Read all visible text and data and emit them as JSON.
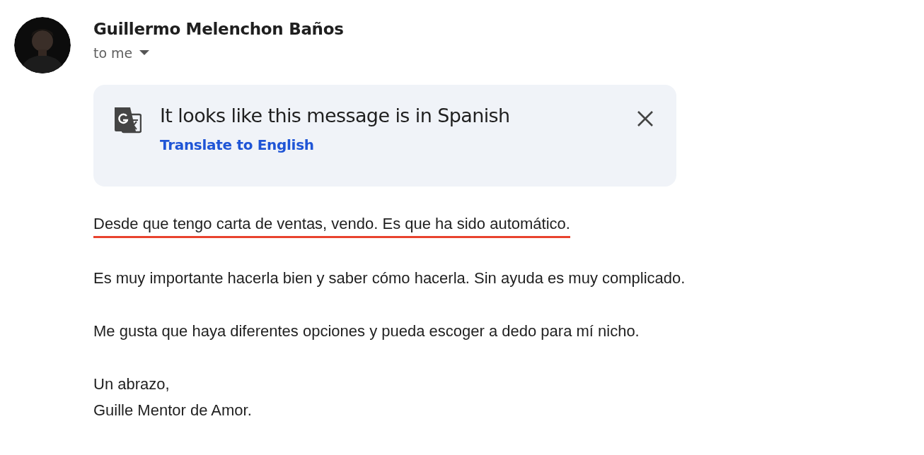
{
  "sender": {
    "name": "Guillermo Melenchon Baños",
    "recipient": "to me"
  },
  "translate_banner": {
    "title": "It looks like this message is in Spanish",
    "action": "Translate to English"
  },
  "body": [
    {
      "lines": [
        "Desde que tengo carta de ventas, vendo. Es que ha sido automático."
      ],
      "underlined": true
    },
    {
      "lines": [
        "Es muy importante hacerla bien y saber cómo hacerla. Sin ayuda es muy complicado."
      ],
      "underlined": false
    },
    {
      "lines": [
        "Me gusta que haya diferentes opciones y pueda escoger a dedo para mí nicho."
      ],
      "underlined": false
    },
    {
      "lines": [
        "Un abrazo,",
        "Guille Mentor de Amor."
      ],
      "underlined": false
    }
  ]
}
